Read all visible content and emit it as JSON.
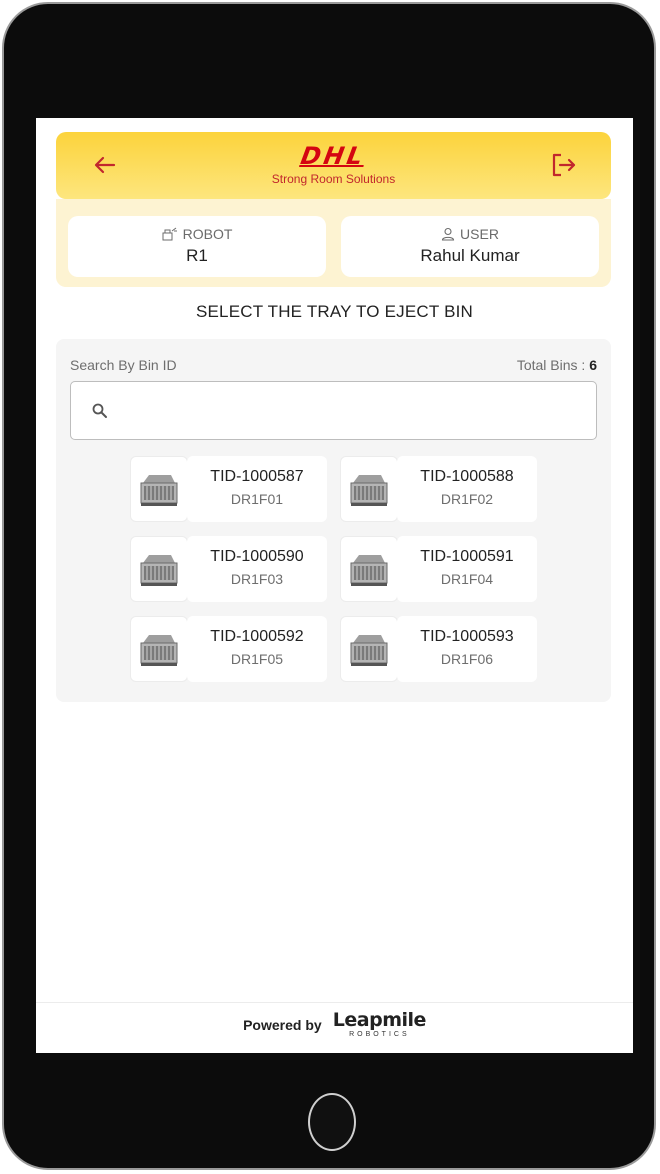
{
  "header": {
    "logo_text": "DHL",
    "subtitle": "Strong Room Solutions"
  },
  "robot": {
    "label": "ROBOT",
    "value": "R1"
  },
  "user": {
    "label": "USER",
    "value": "Rahul Kumar"
  },
  "section_title": "SELECT THE TRAY TO EJECT BIN",
  "search": {
    "label": "Search By Bin ID",
    "placeholder": "",
    "value": ""
  },
  "total": {
    "label": "Total Bins :",
    "count": "6"
  },
  "trays": [
    {
      "id": "TID-1000587",
      "location": "DR1F01"
    },
    {
      "id": "TID-1000588",
      "location": "DR1F02"
    },
    {
      "id": "TID-1000590",
      "location": "DR1F03"
    },
    {
      "id": "TID-1000591",
      "location": "DR1F04"
    },
    {
      "id": "TID-1000592",
      "location": "DR1F05"
    },
    {
      "id": "TID-1000593",
      "location": "DR1F06"
    }
  ],
  "footer": {
    "powered_by": "Powered by",
    "brand_name": "Leapmile",
    "brand_sub": "ROBOTICS"
  },
  "colors": {
    "header_yellow": "#fcd33b",
    "dhl_red": "#d40511",
    "strip_bg": "#fdf3d2",
    "panel_bg": "#f5f5f5"
  }
}
